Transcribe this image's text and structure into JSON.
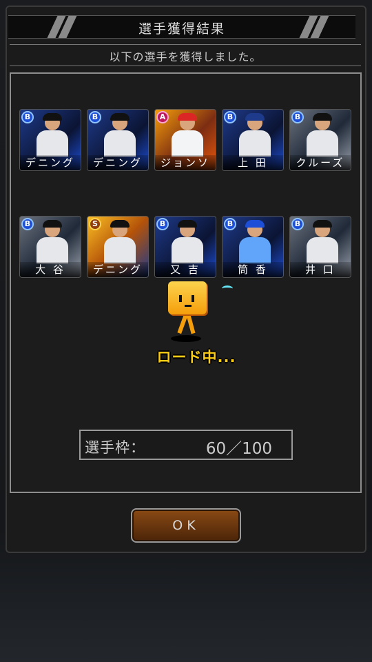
{
  "dialog": {
    "title": "選手獲得結果",
    "subtitle": "以下の選手を獲得しました。"
  },
  "cards": [
    {
      "rank": "B",
      "name": "デニング"
    },
    {
      "rank": "B",
      "name": "デニング"
    },
    {
      "rank": "A",
      "name": "ジョンソン"
    },
    {
      "rank": "B",
      "name": "上 田"
    },
    {
      "rank": "B",
      "name": "クルーズ"
    },
    {
      "rank": "B",
      "name": "大 谷"
    },
    {
      "rank": "S",
      "name": "デニング"
    },
    {
      "rank": "B",
      "name": "又 吉"
    },
    {
      "rank": "B",
      "name": "筒 香"
    },
    {
      "rank": "B",
      "name": "井 口"
    }
  ],
  "loading": {
    "text": "ロード中..."
  },
  "slots": {
    "label": "選手枠：",
    "value": "60／100"
  },
  "ok_button": {
    "label": "OK"
  }
}
